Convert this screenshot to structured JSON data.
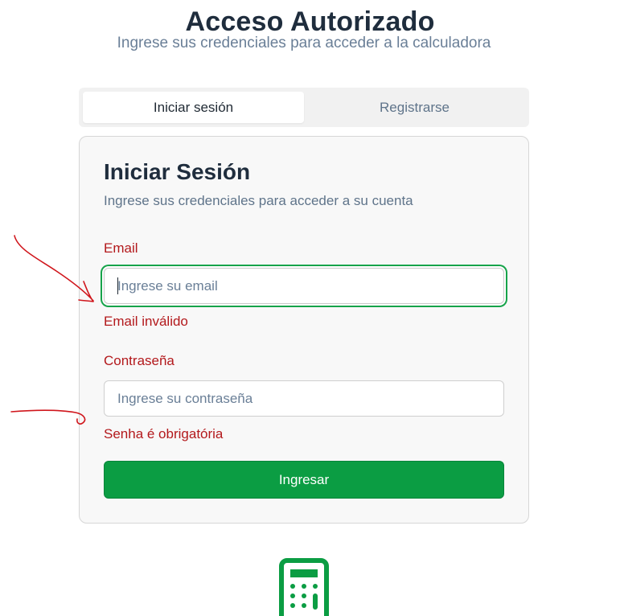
{
  "header": {
    "title": "Acceso Autorizado",
    "subtitle": "Ingrese sus credenciales para acceder a la calculadora"
  },
  "tabs": [
    {
      "label": "Iniciar sesión",
      "active": true
    },
    {
      "label": "Registrarse",
      "active": false
    }
  ],
  "login": {
    "title": "Iniciar Sesión",
    "description": "Ingrese sus credenciales para acceder a su cuenta",
    "email": {
      "label": "Email",
      "placeholder": "Ingrese su email",
      "value": "",
      "error": "Email inválido"
    },
    "password": {
      "label": "Contraseña",
      "placeholder": "Ingrese su contraseña",
      "value": "",
      "error": "Senha é obrigatória"
    },
    "submit_label": "Ingresar"
  },
  "footer": {
    "icon": "calculator-icon"
  },
  "colors": {
    "accent_green": "#0b9d43",
    "error_red": "#b3191c",
    "focus_ring": "#16a34a",
    "annotation_red": "#d0161c",
    "title_dark": "#1f2d3d",
    "muted_text": "#5f748a"
  }
}
